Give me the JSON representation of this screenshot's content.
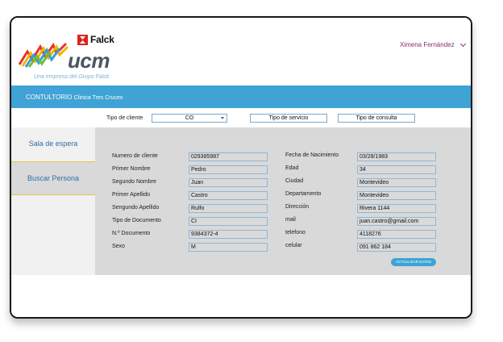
{
  "header": {
    "falck_brand": "Falck",
    "logo_text": "ucm",
    "tagline": "Una empresa del Grupo Falck",
    "user_name": "Ximena Fernández"
  },
  "banner": {
    "title": "CONTULTORIO",
    "subtitle": "Clinica Tres Cruces"
  },
  "filters": {
    "client_type_label": "Tipo de cliente",
    "client_type_value": "CO",
    "service_type_button": "Tipo de servicio",
    "consult_type_button": "Tipo de consulta"
  },
  "sidebar": {
    "items": [
      {
        "label": "Sala de espera"
      },
      {
        "label": "Buscar Persona"
      }
    ]
  },
  "form": {
    "left": [
      {
        "label": "Numero de cliente",
        "value": "029385987"
      },
      {
        "label": "Primer Nombre",
        "value": "Pedro"
      },
      {
        "label": "Segundo Nombre",
        "value": "Juan"
      },
      {
        "label": " Primer Apellido",
        "value": "Castro"
      },
      {
        "label": "Sengundo Apellido",
        "value": "Rulfo"
      },
      {
        "label": "Tipo de Documento",
        "value": "CI"
      },
      {
        "label": "N.º Documento",
        "value": "9384372-4"
      },
      {
        "label": "Sexo",
        "value": "M"
      }
    ],
    "right": [
      {
        "label": "Fecha  de Nacimiento",
        "value": "03/28/1983"
      },
      {
        "label": "Edad",
        "value": "34"
      },
      {
        "label": "Ciudad",
        "value": "Montevideo"
      },
      {
        "label": "Departamento",
        "value": "Montevideo"
      },
      {
        "label": "Dirección",
        "value": "Rivera 1144"
      },
      {
        "label": "mail",
        "value": "juan.castro@gmail.com"
      },
      {
        "label": "telefono",
        "value": "4118276"
      },
      {
        "label": "celular",
        "value": "091 862 184"
      }
    ],
    "update_button": "ACTUALIZAR DATOS"
  },
  "colors": {
    "accent_blue": "#3fa3d6",
    "user_purple": "#8a2d6f",
    "falck_red": "#d7261e"
  }
}
